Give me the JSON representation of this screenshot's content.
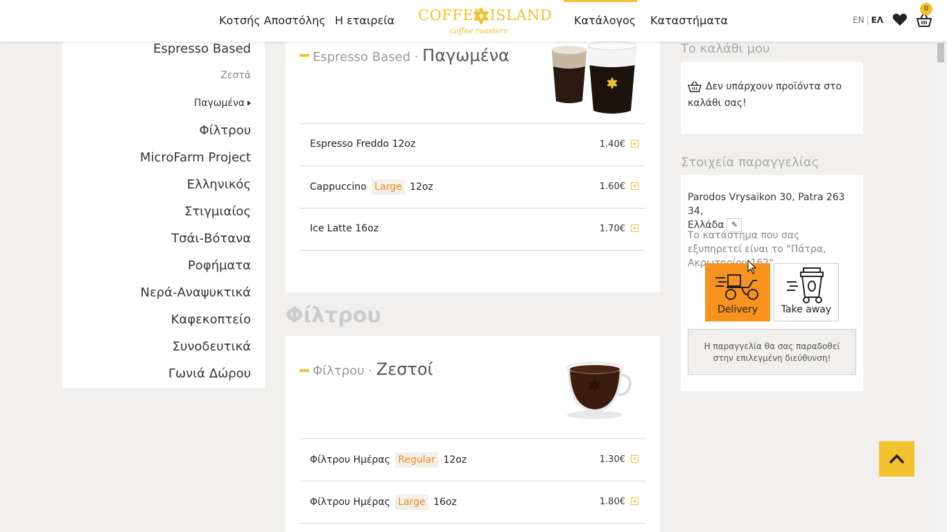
{
  "header": {
    "nav": [
      "Κοτσής Αποστόλης",
      "Η εταιρεία",
      "Κατάλογος",
      "Καταστήματα"
    ],
    "logo": {
      "top": "COFFEE ISLAND",
      "sub": "coffee roasters"
    },
    "lang": {
      "en": "EN",
      "sep": "|",
      "el": "ΕΛ"
    },
    "cart_count": "0"
  },
  "sidebar": {
    "items": [
      {
        "label": "Espresso Based",
        "type": "main"
      },
      {
        "label": "Ζεστά",
        "type": "sub"
      },
      {
        "label": "Παγωμένα",
        "type": "sub-active"
      },
      {
        "label": "Φίλτρου",
        "type": "main"
      },
      {
        "label": "MicroFarm Project",
        "type": "main"
      },
      {
        "label": "Ελληνικός",
        "type": "main"
      },
      {
        "label": "Στιγμιαίος",
        "type": "main"
      },
      {
        "label": "Τσάι-Βότανα",
        "type": "main"
      },
      {
        "label": "Ροφήματα",
        "type": "main"
      },
      {
        "label": "Νερά-Αναψυκτικά",
        "type": "main"
      },
      {
        "label": "Καφεκοπτείο",
        "type": "main"
      },
      {
        "label": "Συνοδευτικά",
        "type": "main"
      },
      {
        "label": "Γωνιά Δώρου",
        "type": "main"
      }
    ]
  },
  "sections": [
    {
      "prefix": "Espresso Based · ",
      "title": "Παγωμένα",
      "products": [
        {
          "name": "Espresso Freddo",
          "tag": "",
          "size": "12oz",
          "price": "1.40€"
        },
        {
          "name": "Cappuccino",
          "tag": "Large",
          "size": "12oz",
          "price": "1.60€"
        },
        {
          "name": "Ice Latte",
          "tag": "",
          "size": "16oz",
          "price": "1.70€"
        }
      ]
    },
    {
      "heading": "Φίλτρου",
      "prefix": "Φίλτρου · ",
      "title": "Ζεστοί",
      "products": [
        {
          "name": "Φίλτρου Ημέρας",
          "tag": "Regular",
          "size": "12oz",
          "price": "1.30€"
        },
        {
          "name": "Φίλτρου Ημέρας",
          "tag": "Large",
          "size": "16oz",
          "price": "1.80€"
        }
      ]
    }
  ],
  "cart": {
    "heading": "Το καλάθι μου",
    "empty_text": "Δεν υπάρχουν προϊόντα στο καλάθι σας!"
  },
  "order": {
    "heading": "Στοιχεία παραγγελίας",
    "address_line1": "Parodos Vrysaikon 30, Patra 263 34,",
    "address_line2": "Ελλάδα",
    "store_text": "Το κατάστημα που σας εξυπηρετεί είναι το \"Πάτρα, Ακρωτηρίου 162\".",
    "options": [
      {
        "label": "Delivery",
        "active": true
      },
      {
        "label": "Take away",
        "active": false
      }
    ],
    "notice": "Η παραγγελία θα σας παραδοθεί στην επιλεγμένη διεύθυνση!"
  },
  "colors": {
    "accent": "#f2c12e",
    "orange": "#f7931e",
    "tag_text": "#f08a1d"
  }
}
